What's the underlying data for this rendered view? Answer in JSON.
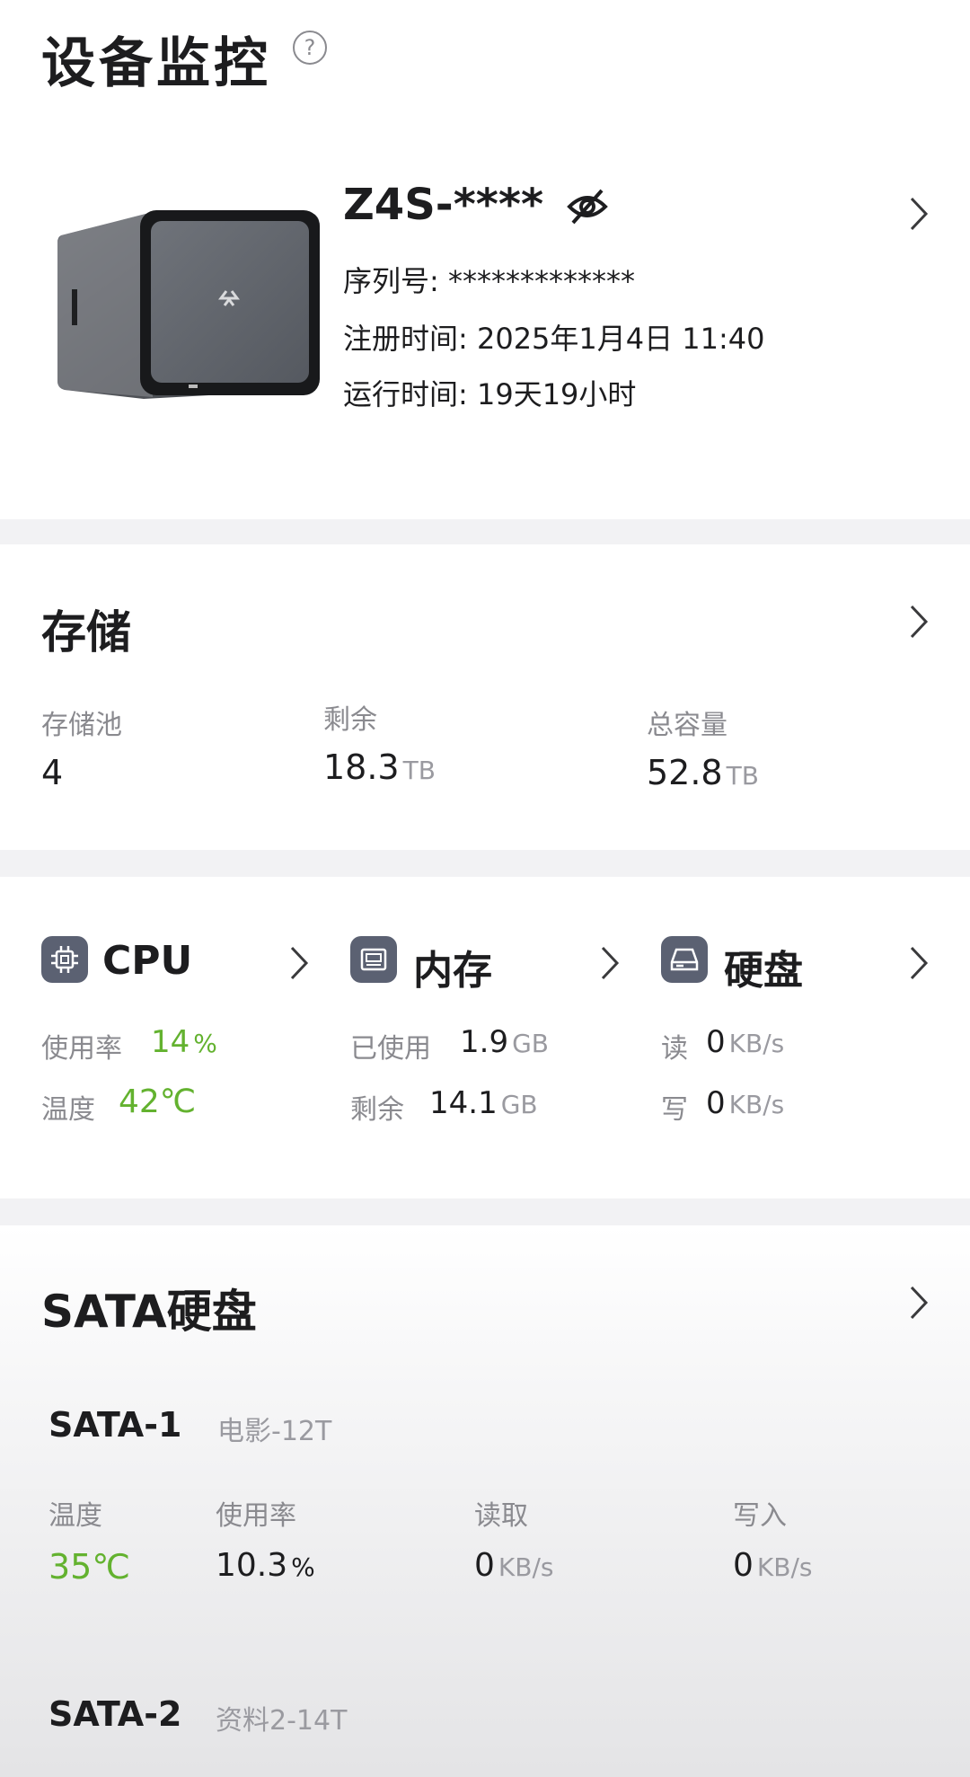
{
  "page": {
    "title": "设备监控"
  },
  "device": {
    "name": "Z4S-****",
    "serial_label": "序列号:",
    "serial_value": "*************",
    "register_label": "注册时间:",
    "register_value": "2025年1月4日 11:40",
    "uptime_label": "运行时间:",
    "uptime_value": "19天19小时"
  },
  "storage": {
    "title": "存储",
    "pool_label": "存储池",
    "pool_value": "4",
    "free_label": "剩余",
    "free_value": "18.3",
    "free_unit": "TB",
    "total_label": "总容量",
    "total_value": "52.8",
    "total_unit": "TB"
  },
  "modules": {
    "cpu": {
      "title": "CPU",
      "usage_label": "使用率",
      "usage_value": "14",
      "usage_unit": "%",
      "temp_label": "温度",
      "temp_value": "42℃"
    },
    "memory": {
      "title": "内存",
      "used_label": "已使用",
      "used_value": "1.9",
      "used_unit": "GB",
      "free_label": "剩余",
      "free_value": "14.1",
      "free_unit": "GB"
    },
    "disk": {
      "title": "硬盘",
      "read_label": "读",
      "read_value": "0",
      "read_unit": "KB/s",
      "write_label": "写",
      "write_value": "0",
      "write_unit": "KB/s"
    }
  },
  "sata": {
    "title": "SATA硬盘",
    "disks": [
      {
        "name": "SATA-1",
        "alias": "电影-12T",
        "temp_label": "温度",
        "temp_value": "35℃",
        "usage_label": "使用率",
        "usage_value": "10.3",
        "usage_unit": "%",
        "read_label": "读取",
        "read_value": "0",
        "read_unit": "KB/s",
        "write_label": "写入",
        "write_value": "0",
        "write_unit": "KB/s"
      },
      {
        "name": "SATA-2",
        "alias": "资料2-14T"
      }
    ]
  },
  "colors": {
    "accent_green": "#63b22f",
    "icon_bg": "#5b6172",
    "page_bg": "#f2f2f4"
  },
  "icons": [
    "help-icon",
    "visibility-off-icon",
    "chevron-right-icon",
    "cpu-icon",
    "memory-icon",
    "disk-icon"
  ]
}
